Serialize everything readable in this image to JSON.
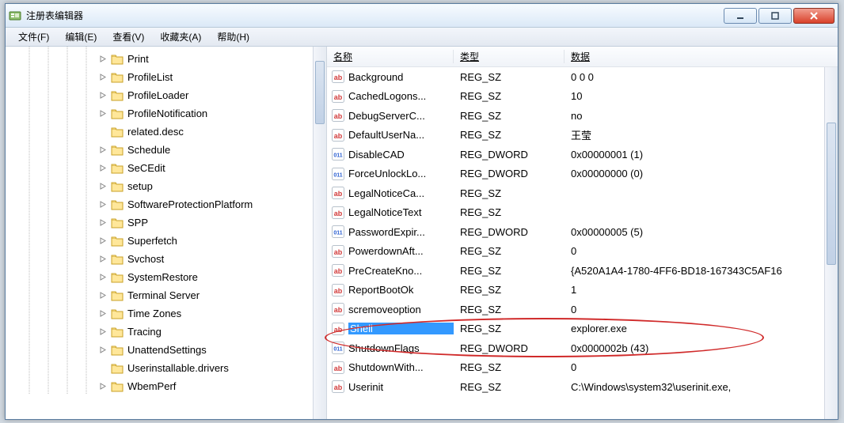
{
  "window": {
    "title": "注册表编辑器"
  },
  "menu": {
    "file": "文件(F)",
    "edit": "编辑(E)",
    "view": "查看(V)",
    "favorites": "收藏夹(A)",
    "help": "帮助(H)"
  },
  "tree": [
    {
      "label": "Print",
      "expandable": true
    },
    {
      "label": "ProfileList",
      "expandable": true
    },
    {
      "label": "ProfileLoader",
      "expandable": true
    },
    {
      "label": "ProfileNotification",
      "expandable": true
    },
    {
      "label": "related.desc",
      "expandable": false
    },
    {
      "label": "Schedule",
      "expandable": true
    },
    {
      "label": "SeCEdit",
      "expandable": true
    },
    {
      "label": "setup",
      "expandable": true
    },
    {
      "label": "SoftwareProtectionPlatform",
      "expandable": true
    },
    {
      "label": "SPP",
      "expandable": true
    },
    {
      "label": "Superfetch",
      "expandable": true
    },
    {
      "label": "Svchost",
      "expandable": true
    },
    {
      "label": "SystemRestore",
      "expandable": true
    },
    {
      "label": "Terminal Server",
      "expandable": true
    },
    {
      "label": "Time Zones",
      "expandable": true
    },
    {
      "label": "Tracing",
      "expandable": true
    },
    {
      "label": "UnattendSettings",
      "expandable": true
    },
    {
      "label": "Userinstallable.drivers",
      "expandable": false
    },
    {
      "label": "WbemPerf",
      "expandable": true
    }
  ],
  "columns": {
    "name": "名称",
    "type": "类型",
    "data": "数据"
  },
  "values": [
    {
      "name": "Background",
      "type": "REG_SZ",
      "data": "0 0 0",
      "icon": "ab"
    },
    {
      "name": "CachedLogons...",
      "type": "REG_SZ",
      "data": "10",
      "icon": "ab"
    },
    {
      "name": "DebugServerC...",
      "type": "REG_SZ",
      "data": "no",
      "icon": "ab"
    },
    {
      "name": "DefaultUserNa...",
      "type": "REG_SZ",
      "data": "王莹",
      "icon": "ab"
    },
    {
      "name": "DisableCAD",
      "type": "REG_DWORD",
      "data": "0x00000001 (1)",
      "icon": "dw"
    },
    {
      "name": "ForceUnlockLo...",
      "type": "REG_DWORD",
      "data": "0x00000000 (0)",
      "icon": "dw"
    },
    {
      "name": "LegalNoticeCa...",
      "type": "REG_SZ",
      "data": "",
      "icon": "ab"
    },
    {
      "name": "LegalNoticeText",
      "type": "REG_SZ",
      "data": "",
      "icon": "ab"
    },
    {
      "name": "PasswordExpir...",
      "type": "REG_DWORD",
      "data": "0x00000005 (5)",
      "icon": "dw"
    },
    {
      "name": "PowerdownAft...",
      "type": "REG_SZ",
      "data": "0",
      "icon": "ab"
    },
    {
      "name": "PreCreateKno...",
      "type": "REG_SZ",
      "data": "{A520A1A4-1780-4FF6-BD18-167343C5AF16",
      "icon": "ab"
    },
    {
      "name": "ReportBootOk",
      "type": "REG_SZ",
      "data": "1",
      "icon": "ab"
    },
    {
      "name": "scremoveoption",
      "type": "REG_SZ",
      "data": "0",
      "icon": "ab"
    },
    {
      "name": "Shell",
      "type": "REG_SZ",
      "data": "explorer.exe",
      "icon": "ab",
      "selected": true
    },
    {
      "name": "ShutdownFlags",
      "type": "REG_DWORD",
      "data": "0x0000002b (43)",
      "icon": "dw"
    },
    {
      "name": "ShutdownWith...",
      "type": "REG_SZ",
      "data": "0",
      "icon": "ab"
    },
    {
      "name": "Userinit",
      "type": "REG_SZ",
      "data": "C:\\Windows\\system32\\userinit.exe,",
      "icon": "ab"
    }
  ]
}
